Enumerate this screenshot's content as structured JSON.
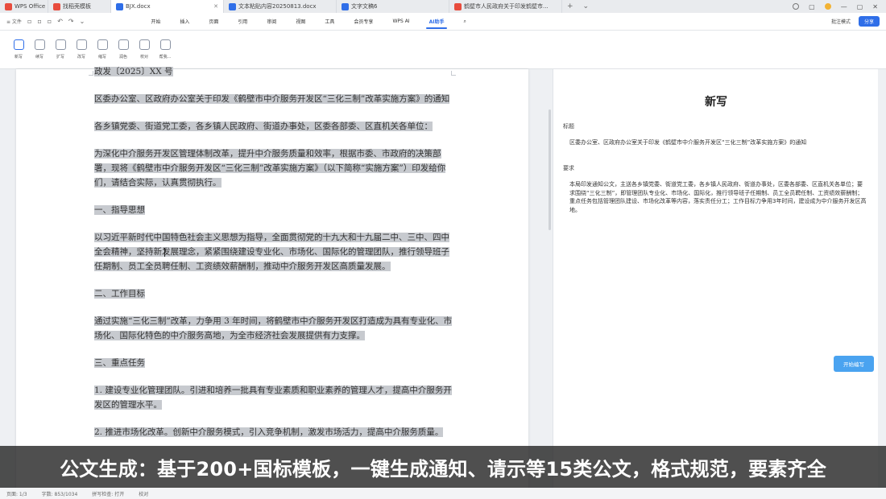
{
  "tabs": [
    {
      "label": "WPS Office",
      "color": "#e84c3d",
      "active": false
    },
    {
      "label": "找稻壳模板",
      "color": "#e84c3d",
      "active": false
    },
    {
      "label": "BJX.docx",
      "color": "#2f6ee8",
      "active": true
    },
    {
      "label": "文本粘贴内容20250813.docx",
      "color": "#2f6ee8",
      "active": false
    },
    {
      "label": "文字文稿6",
      "color": "#2f6ee8",
      "active": false
    },
    {
      "label": "鹤壁市人民政府关于印发鹤壁市...",
      "color": "#e84c3d",
      "active": false
    }
  ],
  "tab_add": "+",
  "tab_dropdown": "⌄",
  "quick_file": "≡ 文件",
  "menus": [
    "开始",
    "插入",
    "页面",
    "引用",
    "审阅",
    "视图",
    "工具",
    "会员专享",
    "WPS AI",
    "AI助手"
  ],
  "active_menu": "AI助手",
  "menu_right": {
    "comment": "批注模式",
    "share": "分享"
  },
  "ribbon": [
    "新写",
    "续写",
    "扩写",
    "改写",
    "缩写",
    "润色",
    "校对",
    "帮我..."
  ],
  "document": {
    "paragraphs": [
      "政发〔2025〕XX 号",
      "区委办公室、区政府办公室关于印发《鹤壁市中介服务开发区“三化三制”改革实施方案》的通知",
      "各乡镇党委、街道党工委，各乡镇人民政府、街道办事处，区委各部委、区直机关各单位：",
      "为深化中介服务开发区管理体制改革，提升中介服务质量和效率，根据市委、市政府的决策部署，现将《鹤壁市中介服务开发区“三化三制”改革实施方案》（以下简称“实施方案”）印发给你们，请结合实际，认真贯彻执行。",
      "一、指导思想",
      "以习近平新时代中国特色社会主义思想为指导，全面贯彻党的十九大和十九届二中、三中、四中全会精神，坚持新发展理念，紧紧围绕建设专业化、市场化、国际化的管理团队，推行领导班子任期制、员工全员聘任制、工资绩效薪酬制，推动中介服务开发区高质量发展。",
      "二、工作目标",
      "通过实施“三化三制”改革，力争用 3 年时间，将鹤壁市中介服务开发区打造成为具有专业化、市场化、国际化特色的中介服务高地，为全市经济社会发展提供有力支撑。",
      "三、重点任务",
      "1. 建设专业化管理团队。引进和培养一批具有专业素质和职业素养的管理人才，提高中介服务开发区的管理水平。",
      "2. 推进市场化改革。创新中介服务模式，引入竞争机制，激发市场活力，提高中介服务质量。"
    ]
  },
  "panel": {
    "title": "新写",
    "topic_label": "标题",
    "topic_value": "区委办公室、区政府办公室关于印发《鹤壁市中介服务开发区“三化三制”改革实施方案》的通知",
    "req_label": "要求",
    "req_text": "本局印发通知公文，主送各乡镇党委、街道党工委，各乡镇人民政府、街道办事处，区委各部委、区直机关各单位；要求围绕“三化三制”，即管理团队专业化、市场化、国际化，推行领导班子任期制、员工全员聘任制、工资绩效薪酬制；重点任务包括管理团队建设、市场化改革等内容，落实责任分工；工作目标力争用3年时间，建设成为中介服务开发区高地。",
    "generate_button": "开始编写"
  },
  "caption": "公文生成：基于200+国标模板，一键生成通知、请示等15类公文，格式规范，要素齐全",
  "status": [
    "页面: 1/3",
    "字数: 853/1034",
    "拼写检查: 打开",
    "校对"
  ]
}
